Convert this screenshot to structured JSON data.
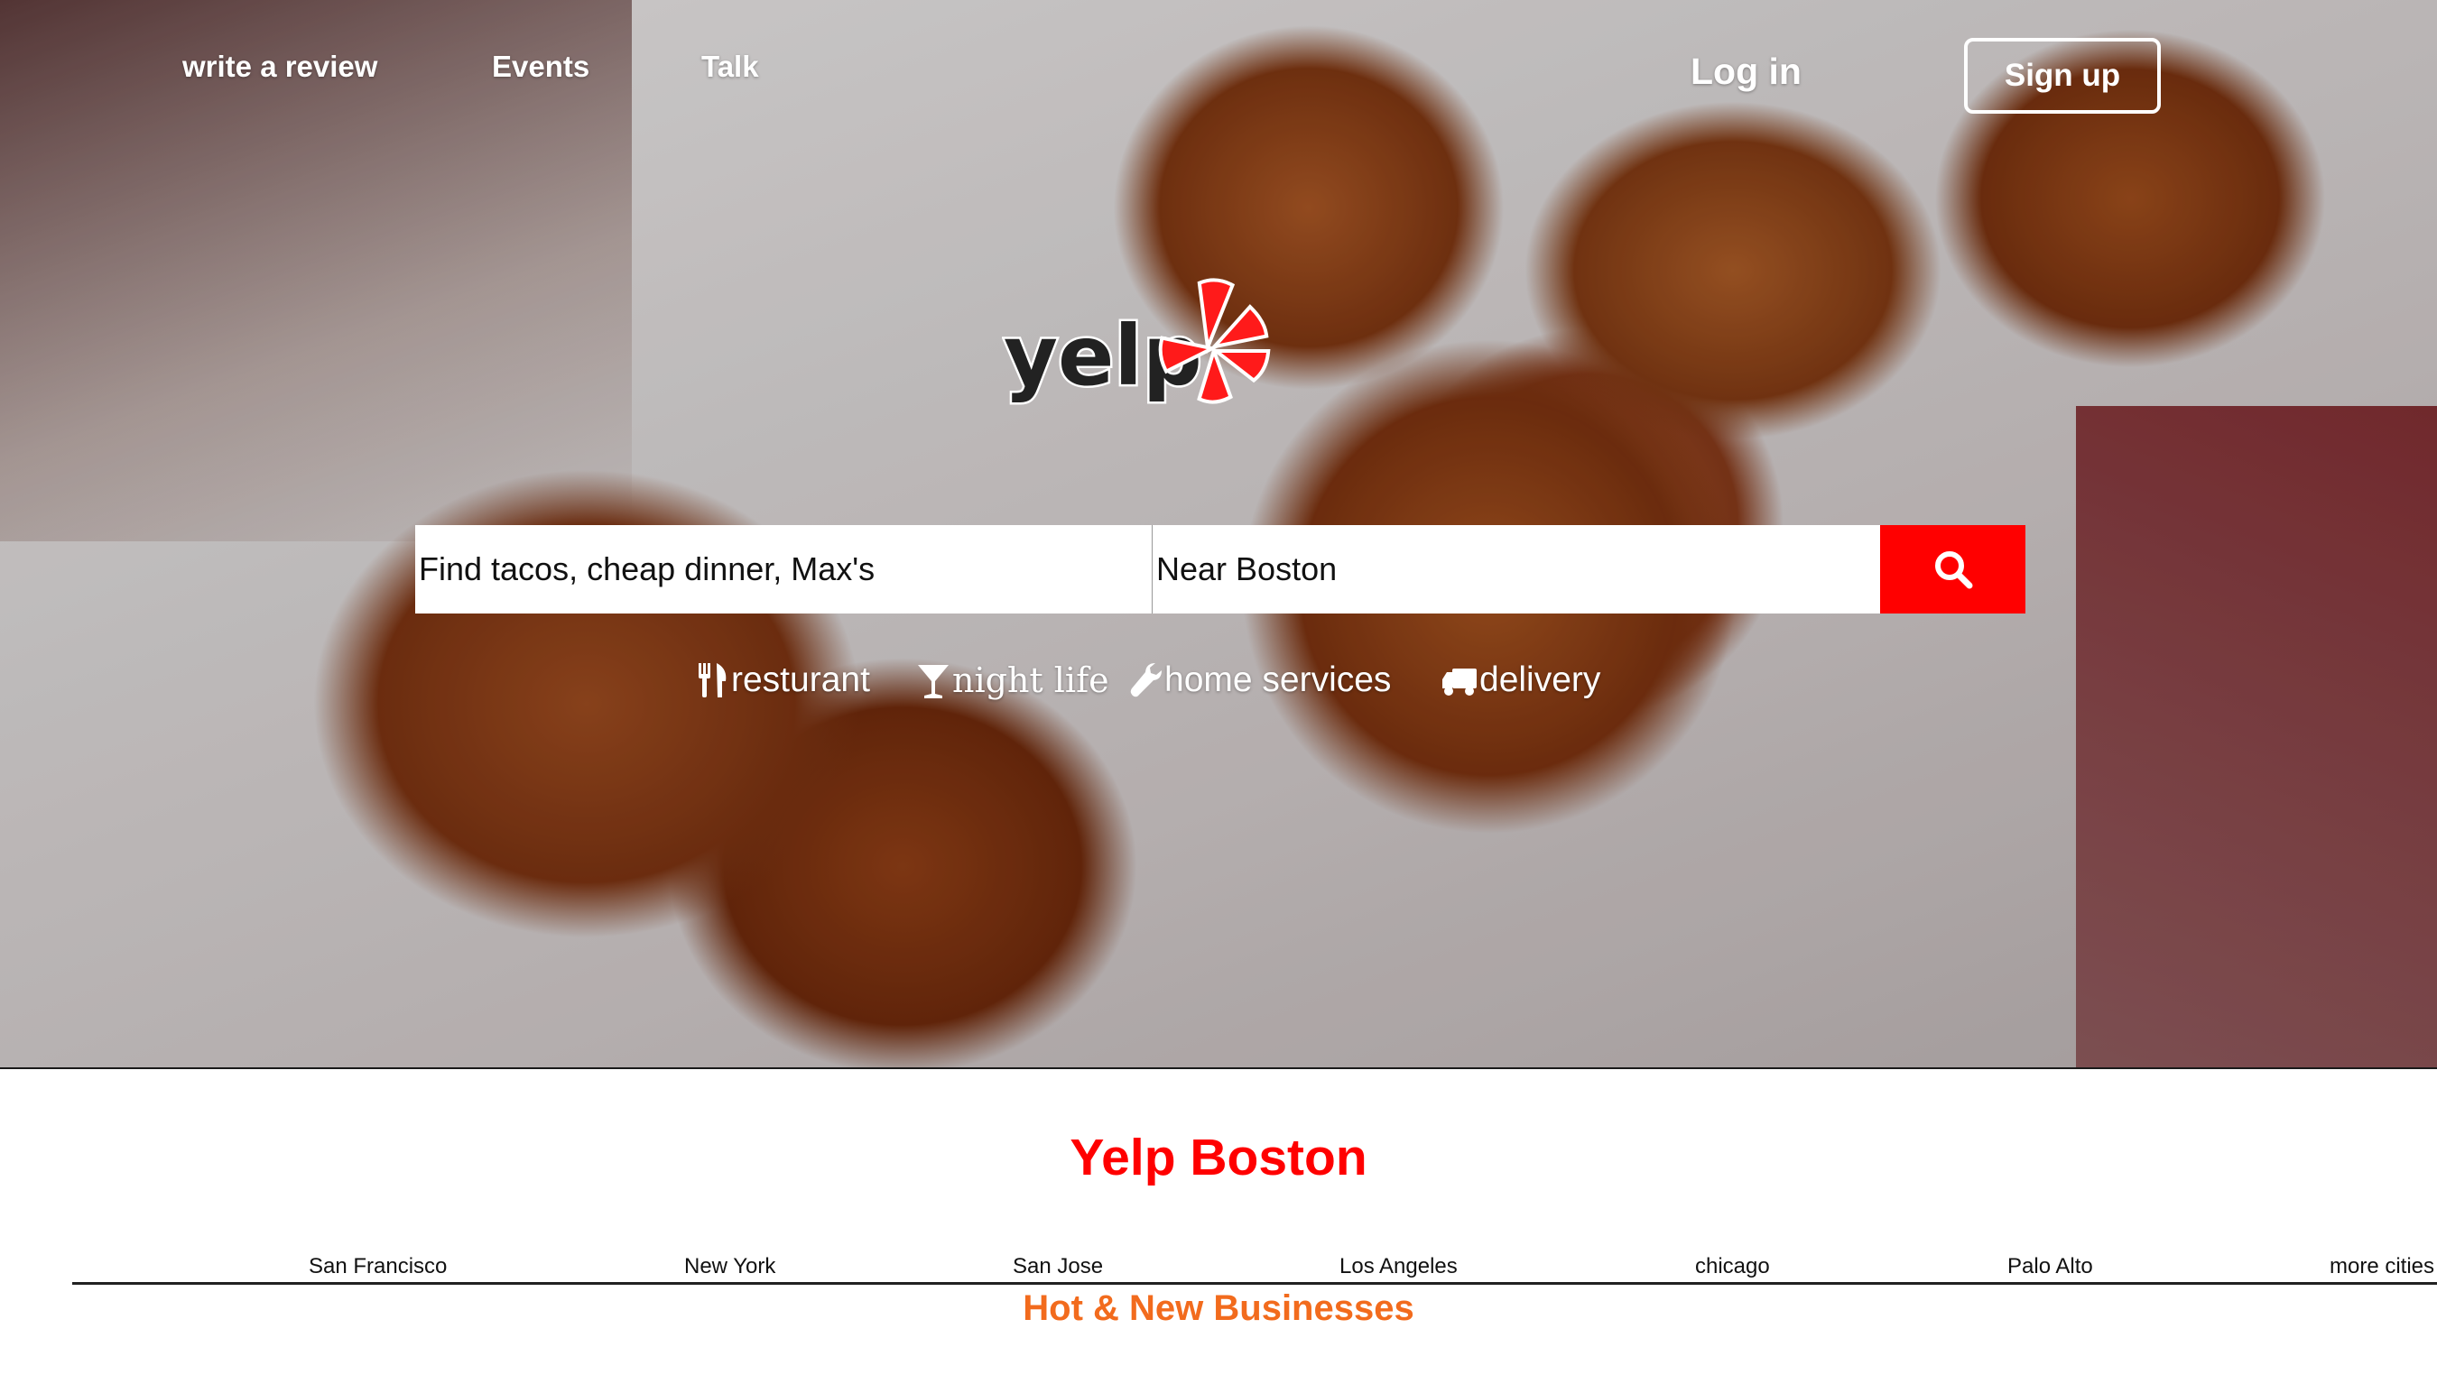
{
  "nav": {
    "write_review": "write a review",
    "events": "Events",
    "talk": "Talk",
    "login": "Log in",
    "signup": "Sign up"
  },
  "logo": {
    "text": "yelp",
    "brand_color": "#ff1a1a"
  },
  "search": {
    "find_value": "Find tacos, cheap dinner, Max's",
    "near_value": "Near Boston",
    "button_icon": "search-icon",
    "button_color": "#ff0000"
  },
  "categories": [
    {
      "label": "resturant",
      "icon": "fork-knife-icon"
    },
    {
      "label": "night life",
      "icon": "cocktail-glass-icon"
    },
    {
      "label": "home services",
      "icon": "wrench-icon"
    },
    {
      "label": "delivery",
      "icon": "truck-icon"
    }
  ],
  "city_section": {
    "title": "Yelp Boston",
    "title_color": "#ff0000",
    "cities": [
      "San Francisco",
      "New York",
      "San Jose",
      "Los Angeles",
      "chicago",
      "Palo Alto",
      "more cities"
    ]
  },
  "hot_new": {
    "title": "Hot & New Businesses",
    "color": "#f26b1d"
  }
}
